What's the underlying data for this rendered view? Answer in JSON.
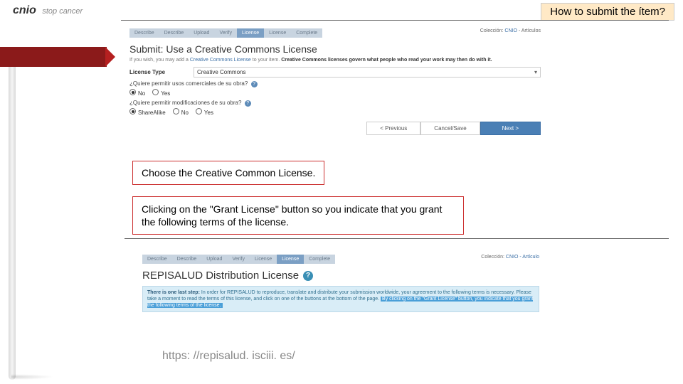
{
  "logo": {
    "brand": "cnio",
    "tagline": "stop cancer"
  },
  "title": "How to submit the ítem?",
  "shot1": {
    "tabs": [
      "Describe",
      "Describe",
      "Upload",
      "Verify",
      "License",
      "License",
      "Complete"
    ],
    "collection_label": "Colección:",
    "collection_link": "CNIO",
    "collection_suffix": "Artículos",
    "heading": "Submit: Use a Creative Commons License",
    "intro_pre": "If you wish, you may add a ",
    "intro_link": "Creative Commons License",
    "intro_post": " to your item. ",
    "intro_bold": "Creative Commons licenses govern what people who read your work may then do with it.",
    "license_label": "License Type",
    "license_value": "Creative Commons",
    "q1": "¿Quiere permitir usos comerciales de su obra?",
    "q2": "¿Quiere permitir modificaciones de su obra?",
    "opt_no": "No",
    "opt_yes": "Yes",
    "opt_sharealike": "ShareAlike",
    "btn_prev": "< Previous",
    "btn_cancel": "Cancel/Save",
    "btn_next": "Next >"
  },
  "note1": "Choose the Creative Common License.",
  "note2": "Clicking on the \"Grant License\" button so you indicate that you grant the following terms of the license.",
  "shot2": {
    "tabs": [
      "Describe",
      "Describe",
      "Upload",
      "Verify",
      "License",
      "License",
      "Complete"
    ],
    "collection_label": "Colección:",
    "collection_link": "CNIO - Artículo",
    "heading": "REPISALUD Distribution License",
    "banner_bold": "There is one last step:",
    "banner_text": " In order for REPISALUD to reproduce, translate and distribute your submission worldwide, your agreement to the following terms is necessary. Please take a moment to read the terms of this license, and click on one of the buttons at the bottom of the page. ",
    "banner_hl": "By clicking on the \"Grant License\" button, you indicate that you grant the following terms of the license."
  },
  "url": "https: //repisalud. isciii. es/"
}
